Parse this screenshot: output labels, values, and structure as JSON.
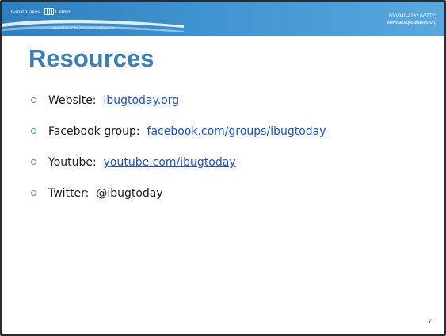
{
  "header": {
    "org_name_left": "Great Lakes",
    "org_name_right": "Center",
    "tagline": "A Member of the ADA National Network",
    "phone": "800-949-4232 (V/TTY)",
    "website": "www.adagreatlakes.org",
    "logo_icon": "ada-center-logo-icon",
    "accent_color": "#3a7fb8"
  },
  "slide": {
    "title": "Resources",
    "page_number": "7",
    "bullets": [
      {
        "label": "Website:",
        "link": "ibugtoday.org"
      },
      {
        "label": "Facebook group:",
        "link": "facebook.com/groups/ibugtoday"
      },
      {
        "label": "Youtube:",
        "link": "youtube.com/ibugtoday"
      },
      {
        "label": "Twitter:",
        "text": "@ibugtoday"
      }
    ]
  }
}
